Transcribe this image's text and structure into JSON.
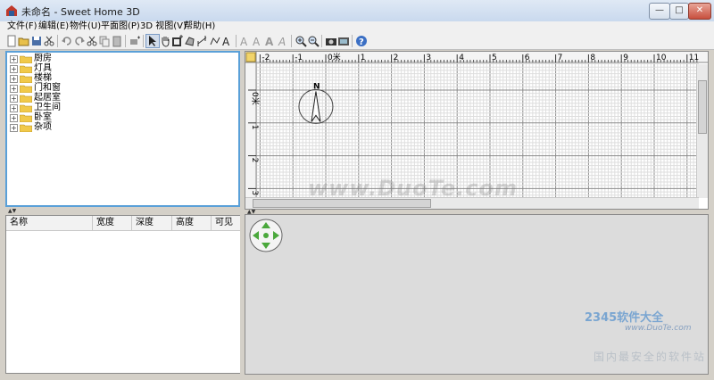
{
  "window": {
    "title": "未命名 - Sweet Home 3D",
    "buttons": {
      "minimize": "—",
      "maximize": "□",
      "close": "✕"
    }
  },
  "menu": [
    "文件(F)",
    "编辑(E)",
    "物件(U)",
    "平面图(P)",
    "3D 视图(V)",
    "帮助(H)"
  ],
  "toolbar": [
    {
      "name": "new-icon",
      "glyph": "new"
    },
    {
      "name": "open-icon",
      "glyph": "open"
    },
    {
      "name": "save-icon",
      "glyph": "save"
    },
    {
      "name": "cut-tool-icon",
      "glyph": "scissors"
    },
    {
      "sep": true
    },
    {
      "name": "undo-icon",
      "glyph": "undo"
    },
    {
      "name": "redo-icon",
      "glyph": "redo"
    },
    {
      "name": "cut-icon",
      "glyph": "scissors"
    },
    {
      "name": "copy-icon",
      "glyph": "copy"
    },
    {
      "name": "paste-icon",
      "glyph": "paste"
    },
    {
      "sep": true
    },
    {
      "name": "add-furniture-icon",
      "glyph": "addfurn"
    },
    {
      "sep": true
    },
    {
      "name": "select-mode-icon",
      "glyph": "arrow",
      "selected": true
    },
    {
      "name": "pan-mode-icon",
      "glyph": "hand"
    },
    {
      "name": "create-walls-icon",
      "glyph": "walls"
    },
    {
      "name": "create-rooms-icon",
      "glyph": "rooms"
    },
    {
      "name": "create-dimensions-icon",
      "glyph": "dim"
    },
    {
      "name": "create-polylines-icon",
      "glyph": "poly"
    },
    {
      "name": "add-text-icon",
      "glyph": "textA"
    },
    {
      "sep": true
    },
    {
      "name": "increase-text-size-icon",
      "glyph": "grayA"
    },
    {
      "name": "decrease-text-size-icon",
      "glyph": "grayA"
    },
    {
      "name": "bold-text-icon",
      "glyph": "boldA"
    },
    {
      "name": "italic-text-icon",
      "glyph": "italA"
    },
    {
      "sep": true
    },
    {
      "name": "zoom-in-icon",
      "glyph": "zoomin"
    },
    {
      "name": "zoom-out-icon",
      "glyph": "zoomout"
    },
    {
      "sep": true
    },
    {
      "name": "create-photo-icon",
      "glyph": "camera"
    },
    {
      "name": "create-video-icon",
      "glyph": "video"
    },
    {
      "sep": true
    },
    {
      "name": "help-icon",
      "glyph": "help"
    }
  ],
  "catalog": {
    "categories": [
      "厨房",
      "灯具",
      "楼梯",
      "门和窗",
      "起居室",
      "卫生间",
      "卧室",
      "杂项"
    ]
  },
  "furniture_table": {
    "columns": [
      "名称",
      "宽度",
      "深度",
      "高度",
      "可见"
    ]
  },
  "plan": {
    "x_ticks": [
      "-2",
      "-1",
      "0米",
      "1",
      "2",
      "3",
      "4",
      "5",
      "6",
      "7",
      "8",
      "9",
      "10",
      "11"
    ],
    "y_ticks": [
      "0米",
      "1",
      "2",
      "3"
    ],
    "compass_label": "N"
  },
  "watermarks": {
    "center": "www.DuoTe.com",
    "logo": "2345软件大全",
    "url": "www.DuoTe.com",
    "cn": "国内最安全的软件站"
  },
  "colors": {
    "selection_border": "#5aa0d8",
    "nav_green": "#4aa83c"
  }
}
